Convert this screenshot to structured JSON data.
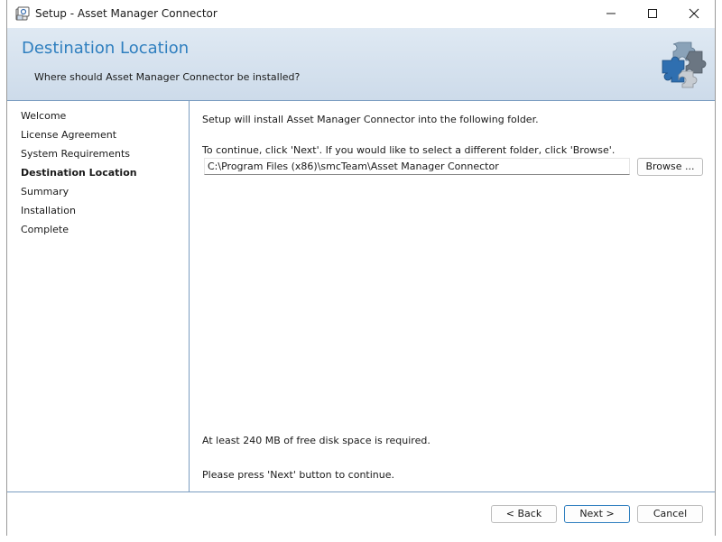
{
  "window": {
    "title": "Setup - Asset Manager Connector",
    "controls": [
      "minimize",
      "maximize",
      "close"
    ]
  },
  "header": {
    "title": "Destination Location",
    "subtitle": "Where should Asset Manager Connector be installed?",
    "icon": "puzzle-pieces-icon",
    "title_color": "#2f7fbf"
  },
  "sidebar": {
    "items": [
      {
        "label": "Welcome",
        "active": false
      },
      {
        "label": "License Agreement",
        "active": false
      },
      {
        "label": "System Requirements",
        "active": false
      },
      {
        "label": "Destination Location",
        "active": true
      },
      {
        "label": "Summary",
        "active": false
      },
      {
        "label": "Installation",
        "active": false
      },
      {
        "label": "Complete",
        "active": false
      }
    ]
  },
  "main": {
    "intro": "Setup will install Asset Manager Connector into the following folder.",
    "instruction": "To continue, click 'Next'. If you would like to select a different folder, click 'Browse'.",
    "path_value": "C:\\Program Files (x86)\\smcTeam\\Asset Manager Connector",
    "browse_label": "Browse ...",
    "disk_space": "At least 240 MB of free disk space is required.",
    "continue_note": "Please press 'Next' button to continue."
  },
  "footer": {
    "back_label": "< Back",
    "next_label": "Next >",
    "cancel_label": "Cancel"
  }
}
